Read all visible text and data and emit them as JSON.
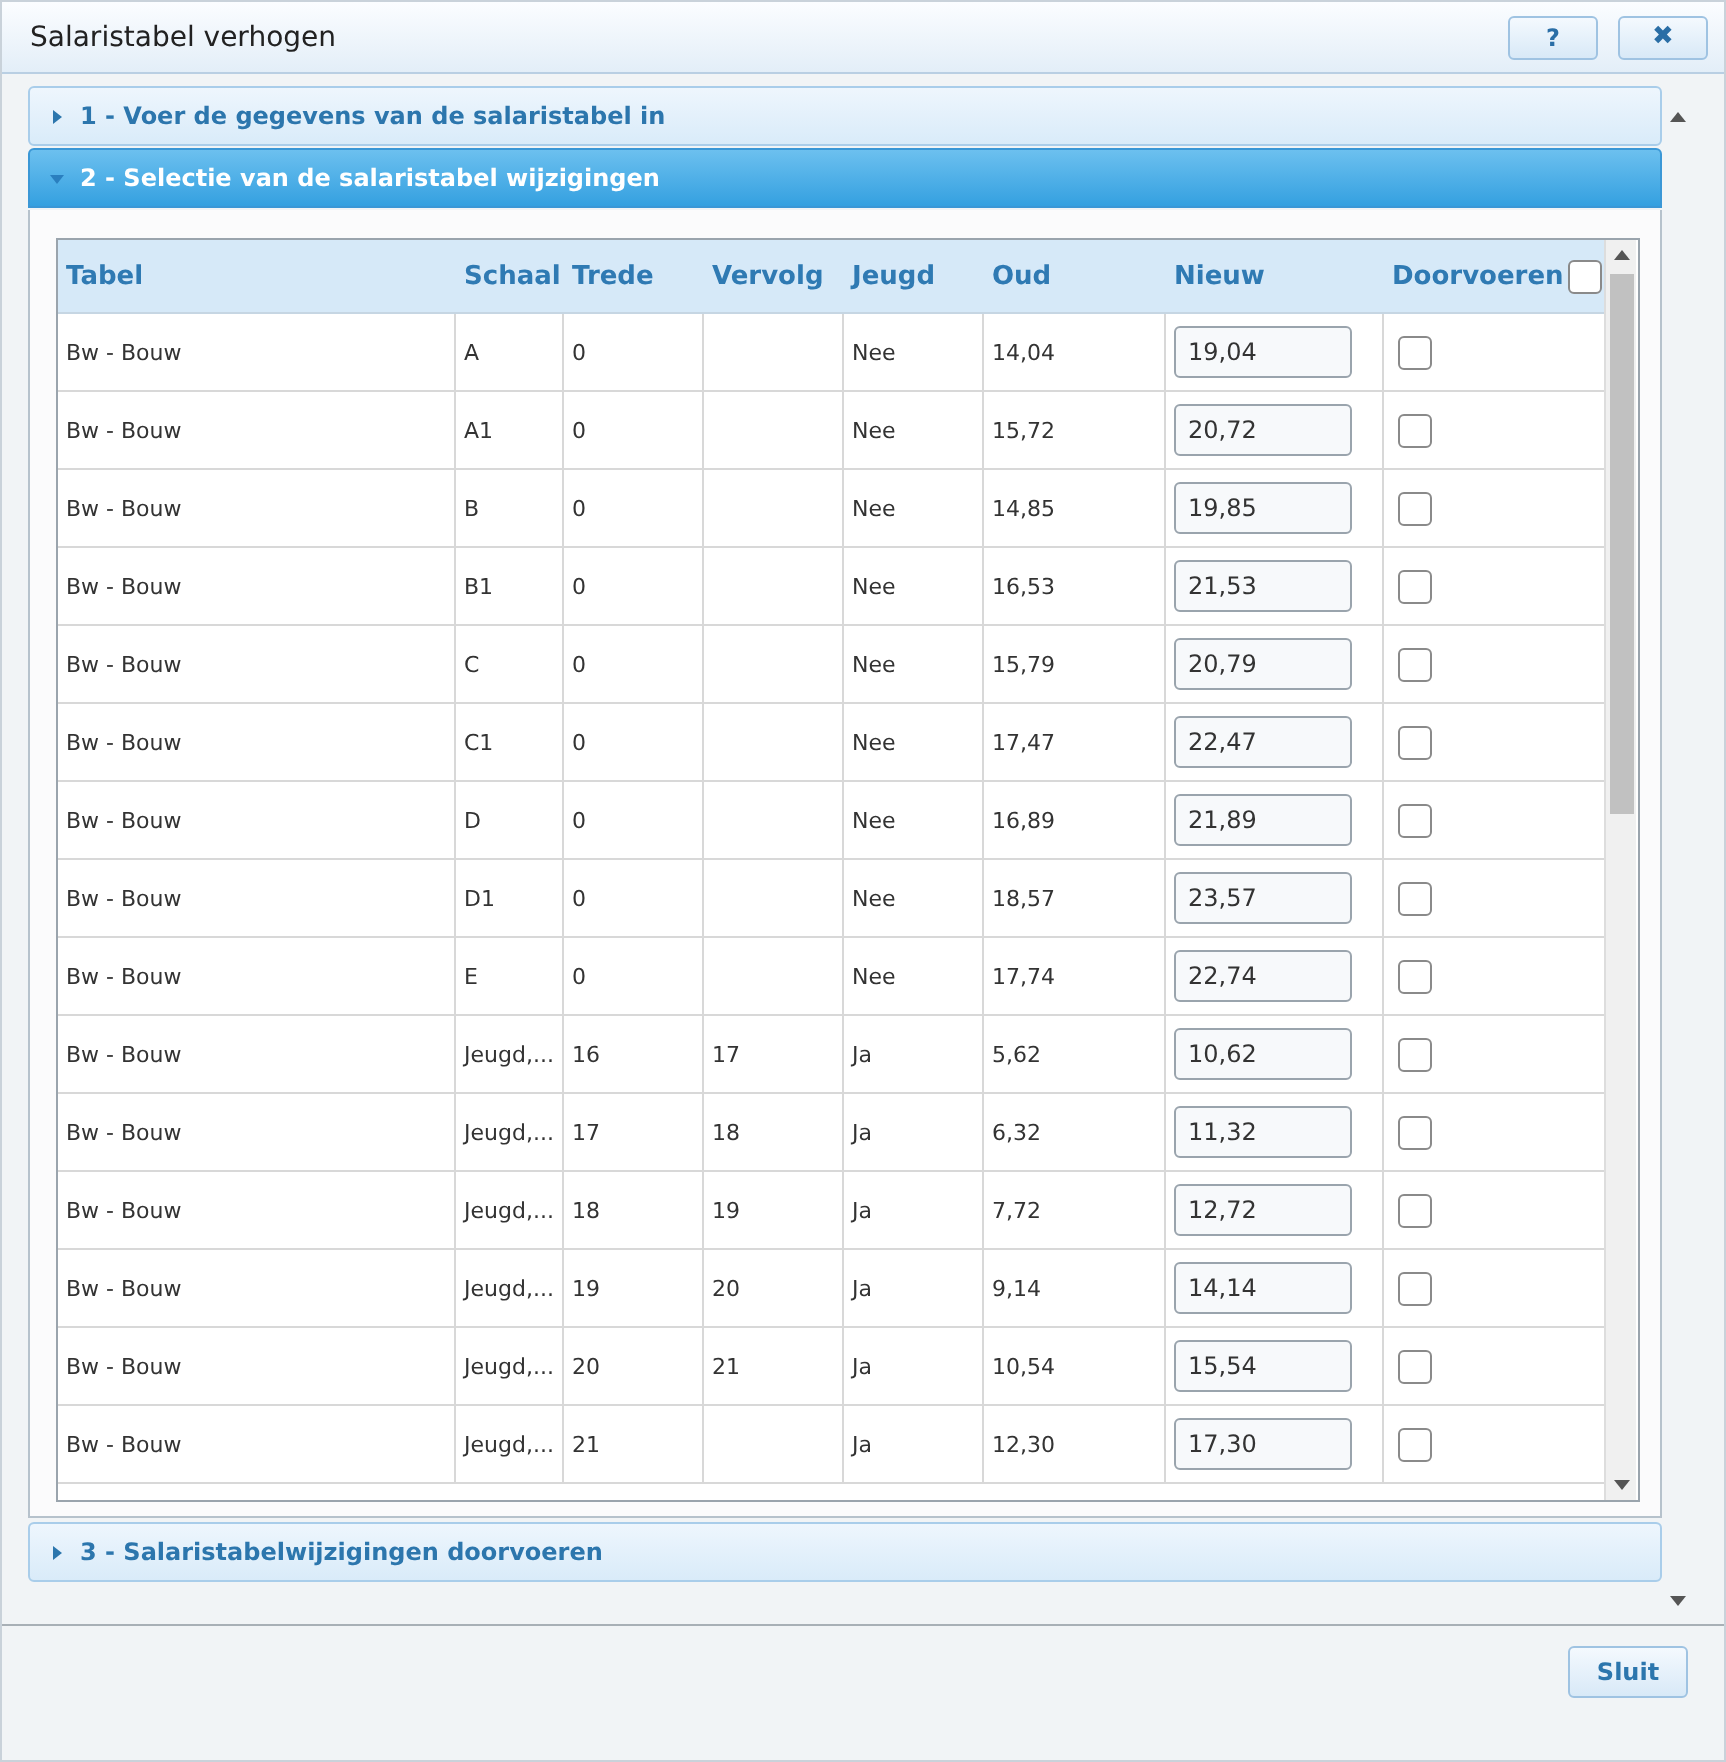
{
  "window": {
    "title": "Salaristabel verhogen",
    "buttons": [
      {
        "kind": "help",
        "label": "?"
      },
      {
        "kind": "close",
        "label": "✖"
      }
    ]
  },
  "sections": [
    {
      "label": "1 - Voer de gegevens van de salaristabel in",
      "expanded": false
    },
    {
      "label": "2 - Selectie van de salaristabel wijzigingen",
      "expanded": true
    },
    {
      "label": "3 - Salaristabelwijzigingen doorvoeren",
      "expanded": false
    }
  ],
  "table": {
    "columns": [
      "Tabel",
      "Schaal",
      "Trede",
      "Vervolg",
      "Jeugd",
      "Oud",
      "Nieuw",
      "Doorvoeren"
    ],
    "select_all": false,
    "rows": [
      {
        "tabel": "Bw - Bouw",
        "schaal": "A",
        "trede": "0",
        "jeugd": "Nee",
        "oud": "14,04",
        "nieuw": "19,04",
        "doorvoeren": false
      },
      {
        "tabel": "Bw - Bouw",
        "schaal": "A1",
        "trede": "0",
        "jeugd": "Nee",
        "oud": "15,72",
        "nieuw": "20,72",
        "doorvoeren": false
      },
      {
        "tabel": "Bw - Bouw",
        "schaal": "B",
        "trede": "0",
        "jeugd": "Nee",
        "oud": "14,85",
        "nieuw": "19,85",
        "doorvoeren": false
      },
      {
        "tabel": "Bw - Bouw",
        "schaal": "B1",
        "trede": "0",
        "jeugd": "Nee",
        "oud": "16,53",
        "nieuw": "21,53",
        "doorvoeren": false
      },
      {
        "tabel": "Bw - Bouw",
        "schaal": "C",
        "trede": "0",
        "jeugd": "Nee",
        "oud": "15,79",
        "nieuw": "20,79",
        "doorvoeren": false
      },
      {
        "tabel": "Bw - Bouw",
        "schaal": "C1",
        "trede": "0",
        "jeugd": "Nee",
        "oud": "17,47",
        "nieuw": "22,47",
        "doorvoeren": false
      },
      {
        "tabel": "Bw - Bouw",
        "schaal": "D",
        "trede": "0",
        "jeugd": "Nee",
        "oud": "16,89",
        "nieuw": "21,89",
        "doorvoeren": false
      },
      {
        "tabel": "Bw - Bouw",
        "schaal": "D1",
        "trede": "0",
        "jeugd": "Nee",
        "oud": "18,57",
        "nieuw": "23,57",
        "doorvoeren": false
      },
      {
        "tabel": "Bw - Bouw",
        "schaal": "E",
        "trede": "0",
        "jeugd": "Nee",
        "oud": "17,74",
        "nieuw": "22,74",
        "doorvoeren": false
      },
      {
        "tabel": "Bw - Bouw",
        "schaal": "Jeugd,...",
        "trede": "16",
        "vervolg": "17",
        "jeugd": "Ja",
        "oud": "5,62",
        "nieuw": "10,62",
        "doorvoeren": false
      },
      {
        "tabel": "Bw - Bouw",
        "schaal": "Jeugd,...",
        "trede": "17",
        "vervolg": "18",
        "jeugd": "Ja",
        "oud": "6,32",
        "nieuw": "11,32",
        "doorvoeren": false
      },
      {
        "tabel": "Bw - Bouw",
        "schaal": "Jeugd,...",
        "trede": "18",
        "vervolg": "19",
        "jeugd": "Ja",
        "oud": "7,72",
        "nieuw": "12,72",
        "doorvoeren": false
      },
      {
        "tabel": "Bw - Bouw",
        "schaal": "Jeugd,...",
        "trede": "19",
        "vervolg": "20",
        "jeugd": "Ja",
        "oud": "9,14",
        "nieuw": "14,14",
        "doorvoeren": false
      },
      {
        "tabel": "Bw - Bouw",
        "schaal": "Jeugd,...",
        "trede": "20",
        "vervolg": "21",
        "jeugd": "Ja",
        "oud": "10,54",
        "nieuw": "15,54",
        "doorvoeren": false
      },
      {
        "tabel": "Bw - Bouw",
        "schaal": "Jeugd,...",
        "trede": "21",
        "jeugd": "Ja",
        "oud": "12,30",
        "nieuw": "17,30",
        "doorvoeren": false
      }
    ]
  },
  "footer": {
    "button": "Sluit"
  }
}
